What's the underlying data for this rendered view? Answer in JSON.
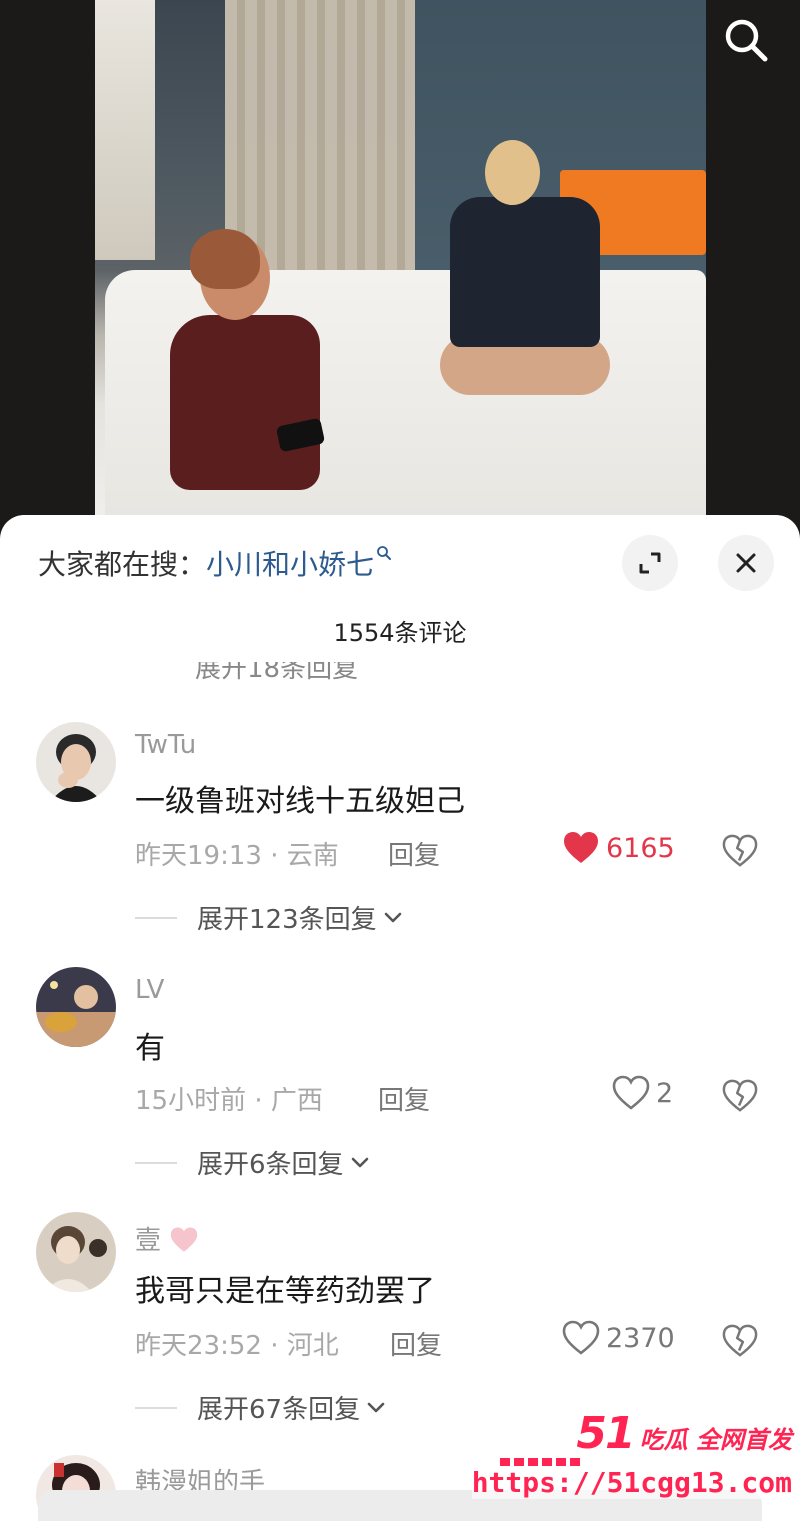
{
  "video": {
    "search_icon": "search-icon"
  },
  "panel": {
    "hot_search_prefix": "大家都在搜：",
    "hot_search_term": "小川和小娇七",
    "expand_icon": "expand-icon",
    "close_icon": "close-icon",
    "comment_count": "1554条评论",
    "cut_off_reply": "展开18条回复"
  },
  "comments": [
    {
      "user": "TwTu",
      "text": "一级鲁班对线十五级妲己",
      "time": "昨天19:13",
      "location": "云南",
      "reply_label": "回复",
      "likes": "6165",
      "liked": true,
      "expand_label": "展开123条回复"
    },
    {
      "user": "LV",
      "text": "有",
      "time": "15小时前",
      "location": "广西",
      "reply_label": "回复",
      "likes": "2",
      "liked": false,
      "expand_label": "展开6条回复"
    },
    {
      "user": "壹",
      "user_suffix_icon": "heart-icon",
      "text": "我哥只是在等药劲罢了",
      "time": "昨天23:52",
      "location": "河北",
      "reply_label": "回复",
      "likes": "2370",
      "liked": false,
      "expand_label": "展开67条回复"
    },
    {
      "user": "韩漫姐的手"
    }
  ],
  "meta_separator": " · ",
  "watermark": {
    "number": "51",
    "tagline": "吃瓜 全网首发",
    "url": "https://51cgg13.com"
  },
  "colors": {
    "liked_red": "#e3364a",
    "hot_term_blue": "#2d5b8f",
    "watermark_red": "#ff2452"
  }
}
